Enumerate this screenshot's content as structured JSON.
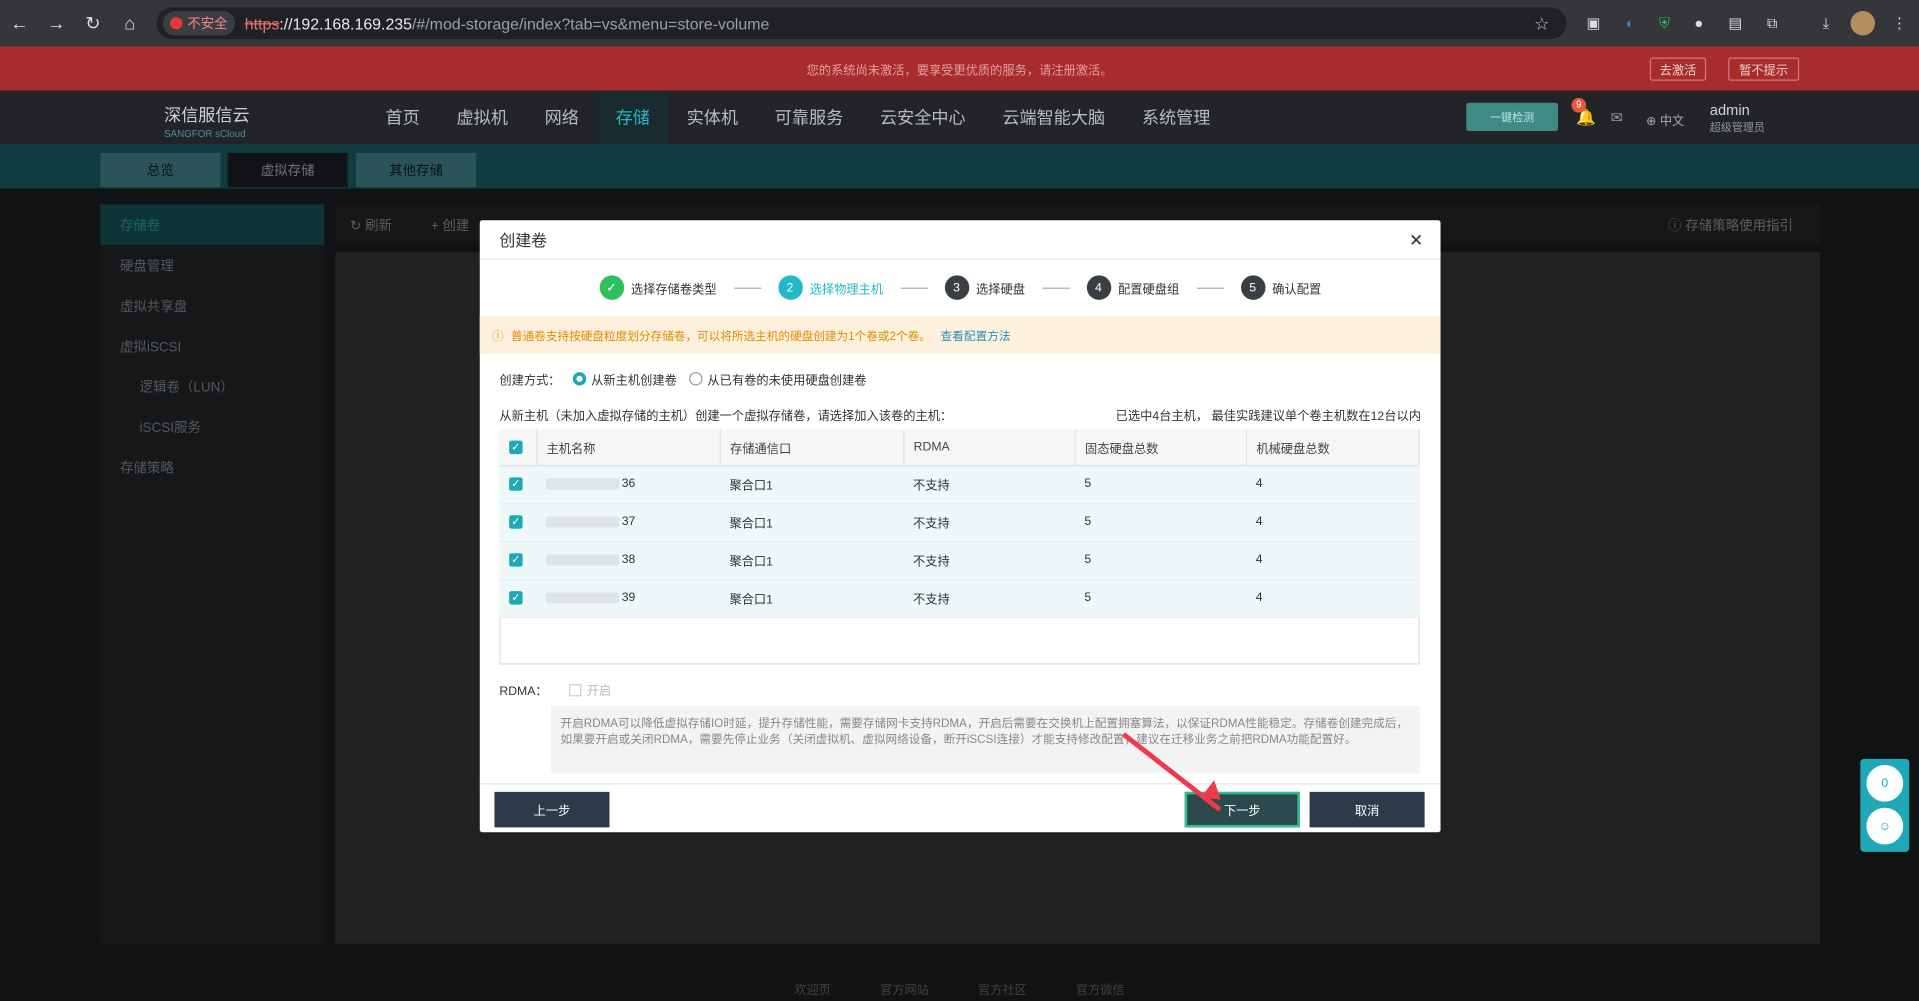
{
  "browser": {
    "insecure_label": "不安全",
    "url_scheme": "https",
    "url_host": "://192.168.169.235",
    "url_path": "/#/mod-storage/index?tab=vs&menu=store-volume"
  },
  "banner": {
    "text": "您的系统尚未激活，要享受更优质的服务，请注册激活。",
    "activate": "去激活",
    "dismiss": "暂不提示"
  },
  "app": {
    "logo": "深信服信云",
    "logo_sub": "SANGFOR sCloud",
    "detect": "一键检测",
    "lang": "中文",
    "user": "admin",
    "role": "超级管理员",
    "notif_count": "9"
  },
  "menu": [
    "首页",
    "虚拟机",
    "网络",
    "存储",
    "实体机",
    "可靠服务",
    "云安全中心",
    "云端智能大脑",
    "系统管理"
  ],
  "subtabs": [
    "总览",
    "虚拟存储",
    "其他存储"
  ],
  "side": [
    "存储卷",
    "硬盘管理",
    "虚拟共享盘",
    "虚拟iSCSI",
    "逻辑卷（LUN）",
    "iSCSI服务",
    "存储策略"
  ],
  "toolbar": {
    "refresh": "刷新",
    "create": "创建",
    "guide": "存储策略使用指引"
  },
  "footer": [
    "欢迎页",
    "官方网站",
    "官方社区",
    "官方微信"
  ],
  "modal": {
    "title": "创建卷",
    "steps": [
      "选择存储卷类型",
      "选择物理主机",
      "选择硬盘",
      "配置硬盘组",
      "确认配置"
    ],
    "step_nums": [
      "2",
      "3",
      "4",
      "5"
    ],
    "tip": "普通卷支持按硬盘粒度划分存储卷，可以将所选主机的硬盘创建为1个卷或2个卷。",
    "tip_link": "查看配置方法",
    "mode_label": "创建方式：",
    "mode_opt1": "从新主机创建卷",
    "mode_opt2": "从已有卷的未使用硬盘创建卷",
    "hint": "从新主机（未加入虚拟存储的主机）创建一个虚拟存储卷，请选择加入该卷的主机：",
    "hint2": "已选中4台主机， 最佳实践建议单个卷主机数在12台以内",
    "columns": [
      "主机名称",
      "存储通信口",
      "RDMA",
      "固态硬盘总数",
      "机械硬盘总数"
    ],
    "rows": [
      {
        "host": "36",
        "port": "聚合口1",
        "rdma": "不支持",
        "ssd": "5",
        "hdd": "4"
      },
      {
        "host": "37",
        "port": "聚合口1",
        "rdma": "不支持",
        "ssd": "5",
        "hdd": "4"
      },
      {
        "host": "38",
        "port": "聚合口1",
        "rdma": "不支持",
        "ssd": "5",
        "hdd": "4"
      },
      {
        "host": "39",
        "port": "聚合口1",
        "rdma": "不支持",
        "ssd": "5",
        "hdd": "4"
      }
    ],
    "rdma_label": "RDMA：",
    "rdma_opt": "开启",
    "rdma_note": "开启RDMA可以降低虚拟存储IO时延，提升存储性能，需要存储网卡支持RDMA，开启后需要在交换机上配置拥塞算法，以保证RDMA性能稳定。存储卷创建完成后，如果要开启或关闭RDMA，需要先停止业务（关闭虚拟机、虚拟网络设备，断开iSCSI连接）才能支持修改配置，建议在迁移业务之前把RDMA功能配置好。",
    "prev": "上一步",
    "next": "下一步",
    "cancel": "取消"
  },
  "float_count": "0"
}
